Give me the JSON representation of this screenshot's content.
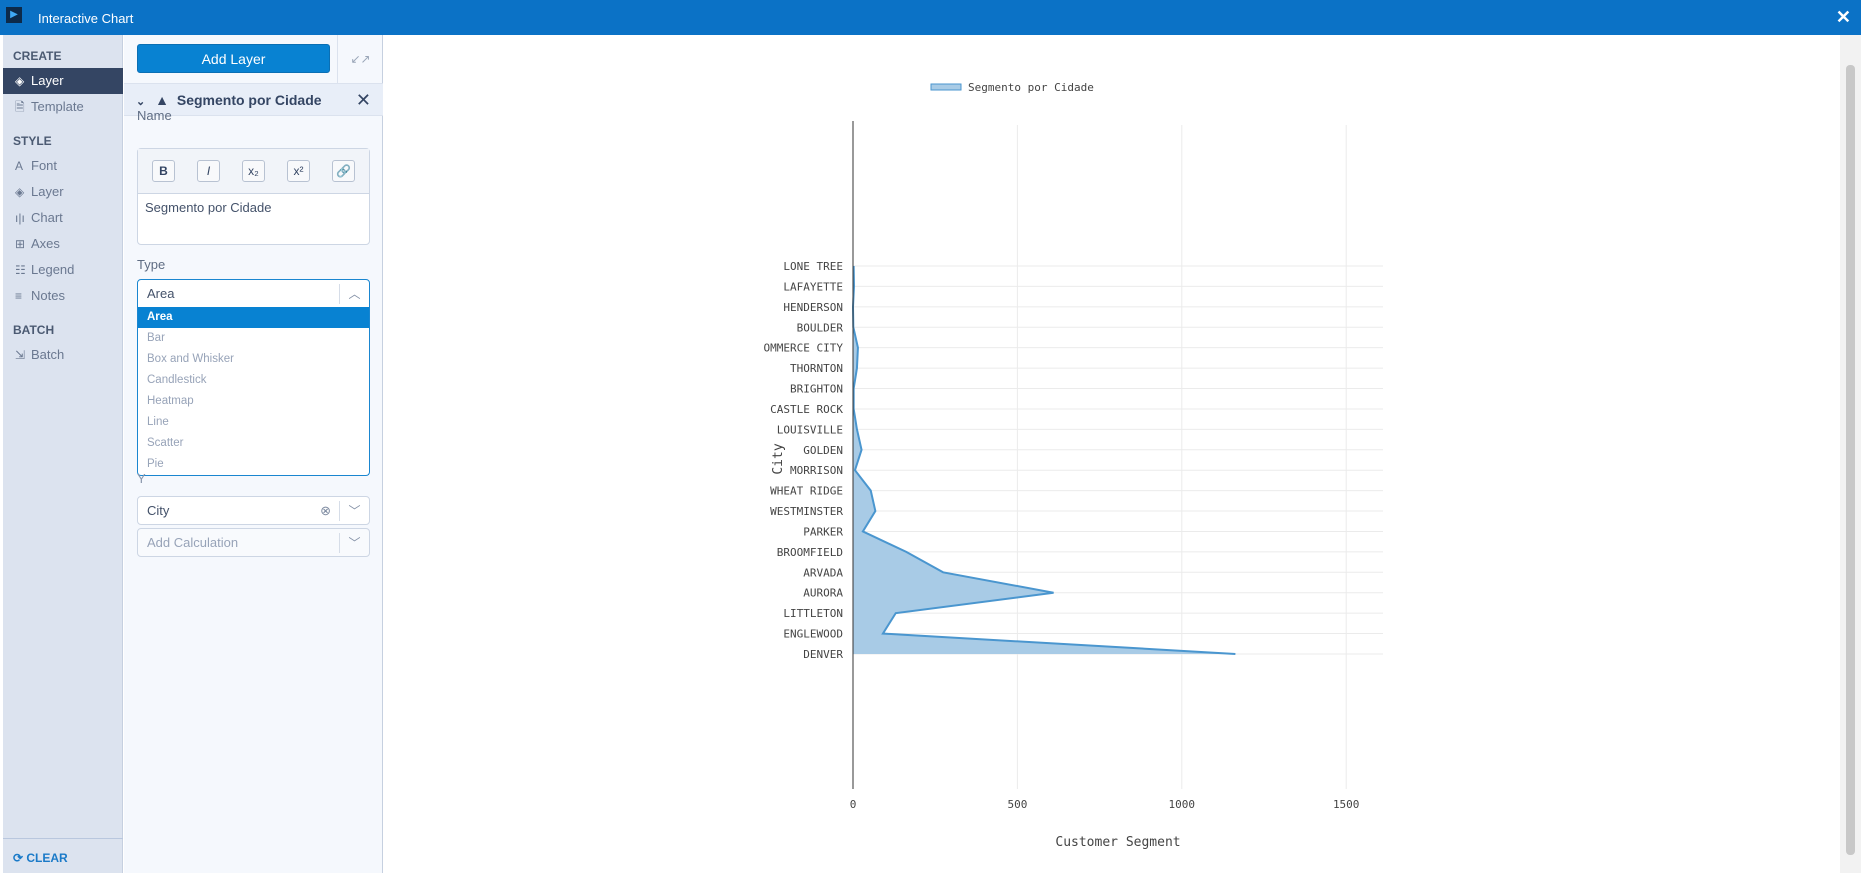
{
  "window": {
    "title": "Interactive Chart",
    "close": "✕"
  },
  "sidebar": {
    "sections": [
      {
        "label": "CREATE",
        "items": [
          {
            "label": "Layer",
            "icon": "layers-icon",
            "active": true
          },
          {
            "label": "Template",
            "icon": "template-icon"
          }
        ]
      },
      {
        "label": "STYLE",
        "items": [
          {
            "label": "Font",
            "icon": "font-icon"
          },
          {
            "label": "Layer",
            "icon": "layers-icon"
          },
          {
            "label": "Chart",
            "icon": "bar-chart-icon"
          },
          {
            "label": "Axes",
            "icon": "grid-icon"
          },
          {
            "label": "Legend",
            "icon": "list-icon"
          },
          {
            "label": "Notes",
            "icon": "lines-icon"
          }
        ]
      },
      {
        "label": "BATCH",
        "items": [
          {
            "label": "Batch",
            "icon": "batch-icon"
          }
        ]
      }
    ],
    "clear": "CLEAR"
  },
  "panel": {
    "add_layer": "Add Layer",
    "layer_title": "Segmento por Cidade",
    "name_label": "Name",
    "toolbar": [
      "B",
      "I",
      "x₂",
      "x²",
      "🔗"
    ],
    "name_value": "Segmento por Cidade",
    "type_label": "Type",
    "type_value": "Area",
    "type_options": [
      "Area",
      "Bar",
      "Box and Whisker",
      "Candlestick",
      "Heatmap",
      "Line",
      "Scatter",
      "Pie"
    ],
    "y_label": "Y",
    "y_value": "City",
    "calc_placeholder": "Add Calculation"
  },
  "colors": {
    "accent": "#0882d2",
    "area_fill": "#a8cbe6",
    "area_line": "#4a96cf"
  },
  "chart_data": {
    "type": "area",
    "orientation": "horizontal",
    "legend": {
      "entries": [
        "Segmento por Cidade"
      ],
      "placement": "top"
    },
    "xlabel": "Customer Segment",
    "ylabel": "City",
    "xlim": [
      0,
      1620
    ],
    "xticks": [
      0,
      500,
      1000,
      1500
    ],
    "grid": true,
    "categories": [
      "LONE TREE",
      "LAFAYETTE",
      "HENDERSON",
      "BOULDER",
      "COMMERCE CITY",
      "THORNTON",
      "BRIGHTON",
      "CASTLE ROCK",
      "LOUISVILLE",
      "GOLDEN",
      "MORRISON",
      "WHEAT RIDGE",
      "WESTMINSTER",
      "PARKER",
      "BROOMFIELD",
      "ARVADA",
      "AURORA",
      "LITTLETON",
      "ENGLEWOOD",
      "DENVER"
    ],
    "category_tick_labels": [
      "LONE TREE",
      "LAFAYETTE",
      "HENDERSON",
      "BOULDER",
      "OMMERCE CITY",
      "THORNTON",
      "BRIGHTON",
      "CASTLE ROCK",
      "LOUISVILLE",
      "GOLDEN",
      "MORRISON",
      "WHEAT RIDGE",
      "WESTMINSTER",
      "PARKER",
      "BROOMFIELD",
      "ARVADA",
      "AURORA",
      "LITTLETON",
      "ENGLEWOOD",
      "DENVER"
    ],
    "values": [
      2,
      3,
      0,
      1,
      15,
      12,
      2,
      2,
      12,
      26,
      6,
      54,
      68,
      30,
      162,
      274,
      610,
      130,
      91,
      1163
    ]
  }
}
